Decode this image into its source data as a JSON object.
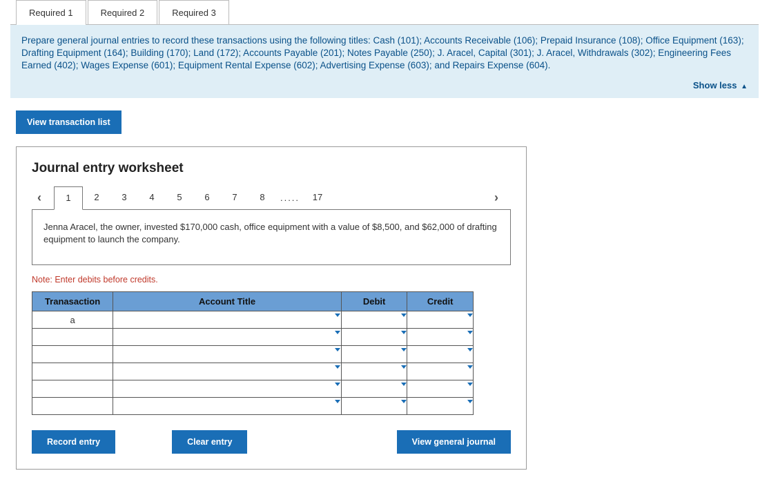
{
  "tabs": {
    "req1": "Required 1",
    "req2": "Required 2",
    "req3": "Required 3"
  },
  "info_text": "Prepare general journal entries to record these transactions using the following titles: Cash (101); Accounts Receivable (106); Prepaid Insurance (108); Office Equipment (163); Drafting Equipment (164); Building (170); Land (172); Accounts Payable (201); Notes Payable (250); J. Aracel, Capital (301); J. Aracel, Withdrawals (302); Engineering Fees Earned (402); Wages Expense (601); Equipment Rental Expense (602); Advertising Expense (603); and Repairs Expense (604).",
  "show_less": "Show less",
  "view_transaction_list": "View transaction list",
  "worksheet": {
    "title": "Journal entry worksheet",
    "pages": {
      "p1": "1",
      "p2": "2",
      "p3": "3",
      "p4": "4",
      "p5": "5",
      "p6": "6",
      "p7": "7",
      "p8": "8",
      "ellipsis": ".....",
      "last": "17"
    },
    "description": "Jenna Aracel, the owner, invested $170,000 cash, office equipment with a value of $8,500, and $62,000 of drafting equipment to launch the company.",
    "note": "Note: Enter debits before credits.",
    "headers": {
      "transaction": "Tranasaction",
      "account_title": "Account Title",
      "debit": "Debit",
      "credit": "Credit"
    },
    "rows": [
      {
        "trans": "a",
        "title": "",
        "debit": "",
        "credit": ""
      },
      {
        "trans": "",
        "title": "",
        "debit": "",
        "credit": ""
      },
      {
        "trans": "",
        "title": "",
        "debit": "",
        "credit": ""
      },
      {
        "trans": "",
        "title": "",
        "debit": "",
        "credit": ""
      },
      {
        "trans": "",
        "title": "",
        "debit": "",
        "credit": ""
      },
      {
        "trans": "",
        "title": "",
        "debit": "",
        "credit": ""
      }
    ],
    "buttons": {
      "record": "Record entry",
      "clear": "Clear entry",
      "view_journal": "View general journal"
    }
  }
}
